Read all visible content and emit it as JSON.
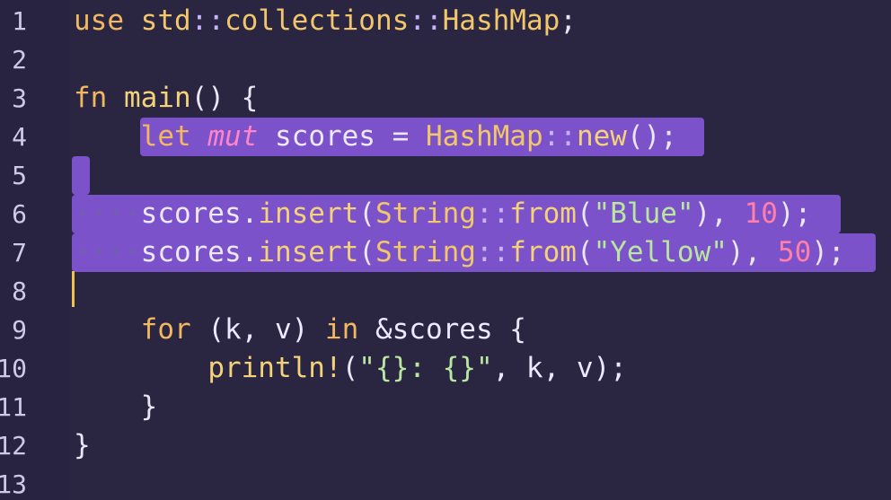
{
  "editor": {
    "line_numbers": [
      "1",
      "2",
      "3",
      "4",
      "5",
      "6",
      "7",
      "8",
      "9",
      "10",
      "11",
      "12",
      "13"
    ],
    "lines": [
      {
        "tokens": [
          {
            "t": "use",
            "c": "kw"
          },
          {
            "t": " ",
            "c": "punc"
          },
          {
            "t": "std",
            "c": "ty"
          },
          {
            "t": "::",
            "c": "ns"
          },
          {
            "t": "collections",
            "c": "ty"
          },
          {
            "t": "::",
            "c": "ns"
          },
          {
            "t": "HashMap",
            "c": "ty"
          },
          {
            "t": ";",
            "c": "punc"
          }
        ]
      },
      {
        "tokens": []
      },
      {
        "tokens": [
          {
            "t": "fn",
            "c": "kw"
          },
          {
            "t": " ",
            "c": "punc"
          },
          {
            "t": "main",
            "c": "fn"
          },
          {
            "t": "() {",
            "c": "punc"
          }
        ]
      },
      {
        "tokens": [
          {
            "t": "    ",
            "c": "punc"
          },
          {
            "t": "let",
            "c": "kw"
          },
          {
            "t": " ",
            "c": "punc"
          },
          {
            "t": "mut",
            "c": "it"
          },
          {
            "t": " scores ",
            "c": "ident"
          },
          {
            "t": "=",
            "c": "punc"
          },
          {
            "t": " ",
            "c": "punc"
          },
          {
            "t": "HashMap",
            "c": "ty"
          },
          {
            "t": "::",
            "c": "ns"
          },
          {
            "t": "new",
            "c": "fn"
          },
          {
            "t": "();",
            "c": "punc"
          }
        ]
      },
      {
        "tokens": []
      },
      {
        "tokens": [
          {
            "t": "····",
            "c": "ws"
          },
          {
            "t": "scores",
            "c": "ident"
          },
          {
            "t": ".",
            "c": "punc"
          },
          {
            "t": "insert",
            "c": "fn"
          },
          {
            "t": "(",
            "c": "punc"
          },
          {
            "t": "String",
            "c": "ty"
          },
          {
            "t": "::",
            "c": "ns"
          },
          {
            "t": "from",
            "c": "fn"
          },
          {
            "t": "(",
            "c": "punc"
          },
          {
            "t": "\"Blue\"",
            "c": "str"
          },
          {
            "t": "), ",
            "c": "punc"
          },
          {
            "t": "10",
            "c": "num"
          },
          {
            "t": ");",
            "c": "punc"
          }
        ]
      },
      {
        "tokens": [
          {
            "t": "····",
            "c": "ws"
          },
          {
            "t": "scores",
            "c": "ident"
          },
          {
            "t": ".",
            "c": "punc"
          },
          {
            "t": "insert",
            "c": "fn"
          },
          {
            "t": "(",
            "c": "punc"
          },
          {
            "t": "String",
            "c": "ty"
          },
          {
            "t": "::",
            "c": "ns"
          },
          {
            "t": "from",
            "c": "fn"
          },
          {
            "t": "(",
            "c": "punc"
          },
          {
            "t": "\"Yellow\"",
            "c": "str"
          },
          {
            "t": "), ",
            "c": "punc"
          },
          {
            "t": "50",
            "c": "num"
          },
          {
            "t": ");",
            "c": "punc"
          }
        ]
      },
      {
        "tokens": []
      },
      {
        "tokens": [
          {
            "t": "    ",
            "c": "punc"
          },
          {
            "t": "for",
            "c": "kw"
          },
          {
            "t": " (k, v) ",
            "c": "ident"
          },
          {
            "t": "in",
            "c": "kw"
          },
          {
            "t": " ",
            "c": "punc"
          },
          {
            "t": "&scores",
            "c": "ident"
          },
          {
            "t": " {",
            "c": "punc"
          }
        ]
      },
      {
        "tokens": [
          {
            "t": "        ",
            "c": "punc"
          },
          {
            "t": "println!",
            "c": "fn"
          },
          {
            "t": "(",
            "c": "punc"
          },
          {
            "t": "\"{}: {}\"",
            "c": "str"
          },
          {
            "t": ", k, v);",
            "c": "ident"
          }
        ]
      },
      {
        "tokens": [
          {
            "t": "    }",
            "c": "punc"
          }
        ]
      },
      {
        "tokens": [
          {
            "t": "}",
            "c": "punc"
          }
        ]
      },
      {
        "tokens": []
      }
    ]
  },
  "colors": {
    "background": "#2a2642",
    "selection": "#7b52c9",
    "cursor": "#f0c24b"
  }
}
